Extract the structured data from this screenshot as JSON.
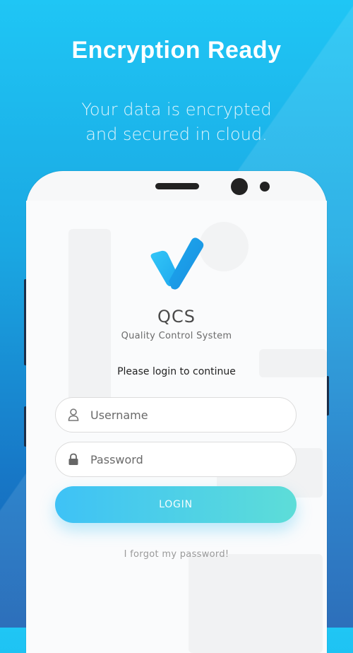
{
  "promo": {
    "title": "Encryption Ready",
    "subtitle_line1": "Your data is encrypted",
    "subtitle_line2": "and secured in cloud."
  },
  "app": {
    "logo_icon": "checkmark-icon",
    "name": "QCS",
    "full_name": "Quality Control System",
    "prompt": "Please login to continue"
  },
  "form": {
    "username_placeholder": "Username",
    "username_icon": "user-icon",
    "password_placeholder": "Password",
    "password_icon": "lock-icon",
    "login_label": "LOGIN",
    "forgot_label": "I forgot my password!"
  },
  "colors": {
    "background_top": "#1fc6f5",
    "background_bottom": "#155fb3",
    "button_start": "#3ec2f6",
    "button_end": "#5dddd8",
    "logo_blue": "#1c8fe0"
  }
}
